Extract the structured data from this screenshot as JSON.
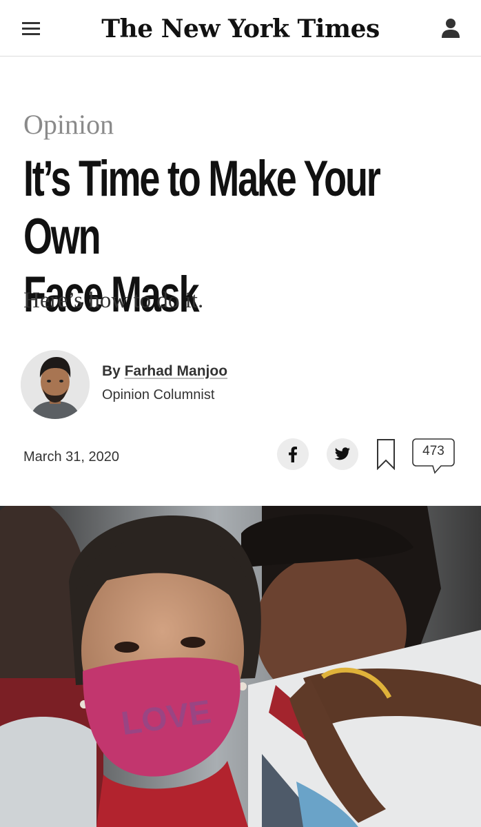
{
  "header": {
    "masthead": "The New York Times",
    "menu_icon": "hamburger-menu-icon",
    "account_icon": "user-account-icon"
  },
  "article": {
    "section": "Opinion",
    "headline_line1": "It’s Time to Make Your Own",
    "headline_line2": "Face Mask",
    "summary": "Here’s how to do it.",
    "byline_prefix": "By ",
    "author": "Farhad Manjoo",
    "author_role": "Opinion Columnist",
    "date": "March 31, 2020"
  },
  "sharing": {
    "facebook_icon": "facebook-icon",
    "twitter_icon": "twitter-icon",
    "bookmark_icon": "bookmark-icon",
    "comment_count": "473"
  },
  "colors": {
    "section_gray": "#8a8a8a",
    "text": "#121212",
    "share_bg": "#ececec",
    "mask_pink": "#c2366e"
  }
}
